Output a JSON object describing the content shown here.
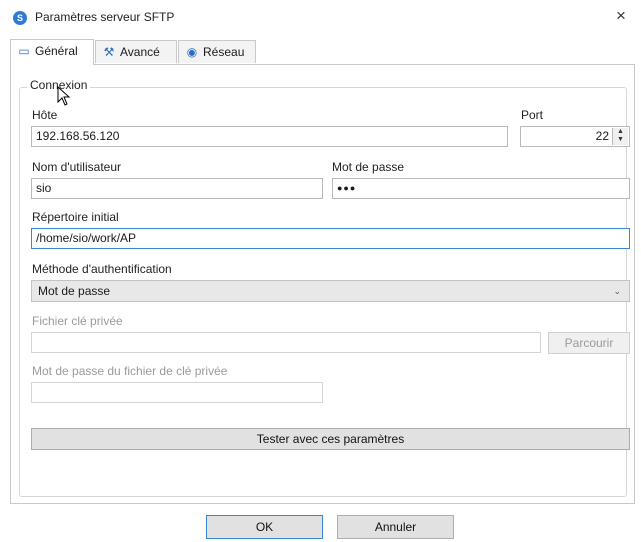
{
  "window": {
    "title": "Paramètres serveur SFTP",
    "close_glyph": "×",
    "app_icon_glyph": "S"
  },
  "tabs": [
    {
      "label": "Général",
      "icon": "monitor-icon",
      "glyph": "▭",
      "active": true
    },
    {
      "label": "Avancé",
      "icon": "wrench-icon",
      "glyph": "⚒",
      "active": false
    },
    {
      "label": "Réseau",
      "icon": "network-icon",
      "glyph": "◉",
      "active": false
    }
  ],
  "connexion": {
    "legend": "Connexion",
    "host_label": "Hôte",
    "host_value": "192.168.56.120",
    "port_label": "Port",
    "port_value": "22",
    "user_label": "Nom d'utilisateur",
    "user_value": "sio",
    "password_label": "Mot de passe",
    "password_value": "●●●",
    "initial_dir_label": "Répertoire initial",
    "initial_dir_value": "/home/sio/work/AP",
    "auth_method_label": "Méthode d'authentification",
    "auth_method_value": "Mot de passe",
    "private_key_label": "Fichier clé privée",
    "private_key_value": "",
    "browse_label": "Parcourir",
    "key_password_label": "Mot de passe du fichier de clé privée",
    "key_password_value": "",
    "test_button_label": "Tester avec ces paramètres"
  },
  "footer": {
    "ok_label": "OK",
    "cancel_label": "Annuler"
  },
  "colors": {
    "accent": "#3a86d4",
    "disabled_text": "#9a9a9a"
  }
}
